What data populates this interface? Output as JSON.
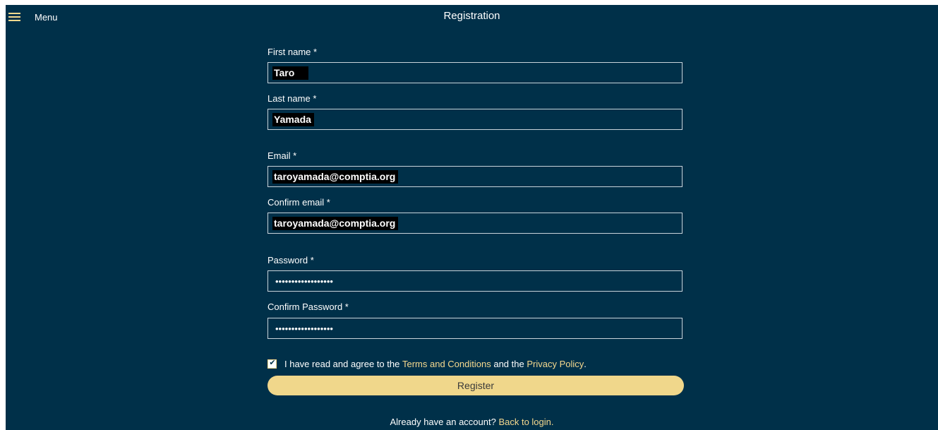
{
  "header": {
    "menu_label": "Menu",
    "title": "Registration"
  },
  "form": {
    "first_name": {
      "label": "First name *",
      "value": "Taro"
    },
    "last_name": {
      "label": "Last name *",
      "value": "Yamada"
    },
    "email": {
      "label": "Email *",
      "value": "taroyamada@comptia.org"
    },
    "confirm_email": {
      "label": "Confirm email *",
      "value": "taroyamada@comptia.org"
    },
    "password": {
      "label": "Password *",
      "value": "••••••••••••••••••"
    },
    "confirm_password": {
      "label": "Confirm Password *",
      "value": "••••••••••••••••••"
    },
    "agree": {
      "checked": true,
      "text_before": "I have read and agree to the",
      "terms_link": "Terms and Conditions",
      "text_middle": "and the",
      "privacy_link": "Privacy Policy",
      "text_after": "."
    },
    "register_label": "Register"
  },
  "footer": {
    "prompt": "Already have an account?",
    "login_link": "Back to login."
  },
  "colors": {
    "background": "#003049",
    "accent": "#f6d98e",
    "button": "#f0d78b"
  }
}
